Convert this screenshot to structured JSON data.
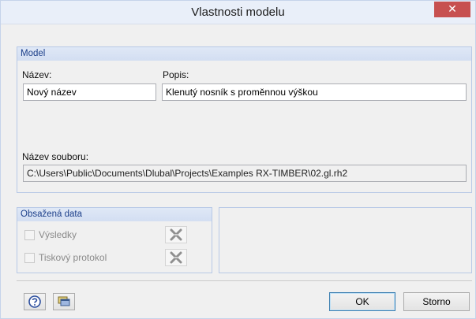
{
  "window": {
    "title": "Vlastnosti modelu",
    "close_glyph": "✕"
  },
  "model": {
    "header": "Model",
    "name_label": "Název:",
    "name_value": "Nový název",
    "desc_label": "Popis:",
    "desc_value": "Klenutý nosník s proměnnou výškou",
    "file_label": "Název souboru:",
    "file_value": "C:\\Users\\Public\\Documents\\Dlubal\\Projects\\Examples RX-TIMBER\\02.gl.rh2"
  },
  "contained_data": {
    "header": "Obsažená data",
    "items": [
      {
        "label": "Výsledky",
        "checked": false,
        "enabled": false,
        "delete_icon": "delete-x-icon"
      },
      {
        "label": "Tiskový protokol",
        "checked": false,
        "enabled": false,
        "delete_icon": "delete-x-icon"
      }
    ]
  },
  "footer": {
    "help_icon": "help-icon",
    "copy_icon": "windows-icon",
    "ok_label": "OK",
    "cancel_label": "Storno"
  },
  "colors": {
    "title_bg": "#e9eff9",
    "close_bg": "#c75050",
    "group_header_text": "#1c3f8a",
    "group_border": "#b8c9e6"
  }
}
